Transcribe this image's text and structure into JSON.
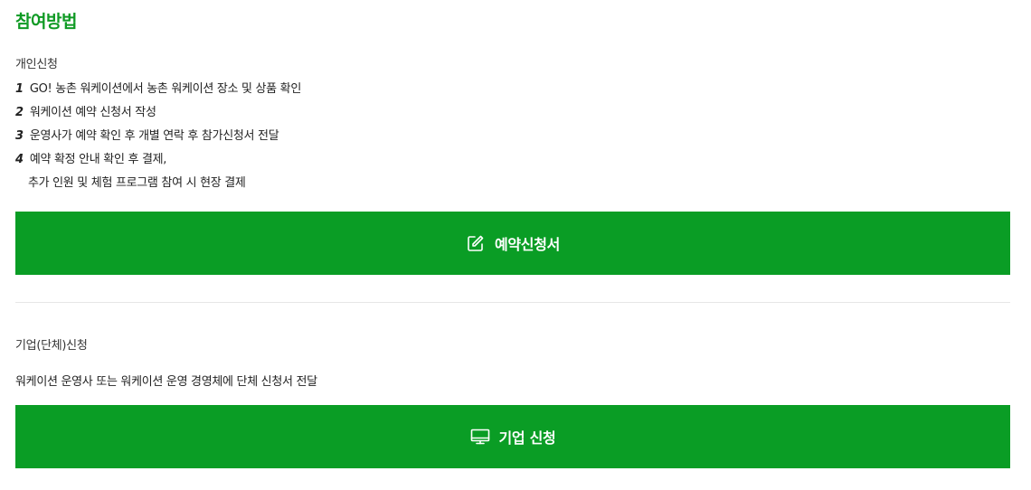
{
  "title": "참여방법",
  "personal": {
    "label": "개인신청",
    "steps": [
      {
        "num": "1",
        "text": "GO! 농촌 워케이션에서 농촌 워케이션 장소 및 상품 확인"
      },
      {
        "num": "2",
        "text": "워케이션 예약 신청서 작성"
      },
      {
        "num": "3",
        "text": "운영사가 예약 확인 후 개별 연락 후 참가신청서 전달"
      },
      {
        "num": "4",
        "text": "예약 확정 안내 확인 후 결제,",
        "cont": "추가 인원 및 체험 프로그램 참여 시 현장 결제"
      }
    ],
    "button_label": "예약신청서",
    "button_icon": "edit-icon"
  },
  "corporate": {
    "label": "기업(단체)신청",
    "description": "워케이션 운영사 또는 워케이션 운영 경영체에 단체 신청서 전달",
    "button_label": "기업 신청",
    "button_icon": "monitor-icon"
  },
  "colors": {
    "accent": "#0f9a24",
    "button_bg": "#0a9d25"
  }
}
